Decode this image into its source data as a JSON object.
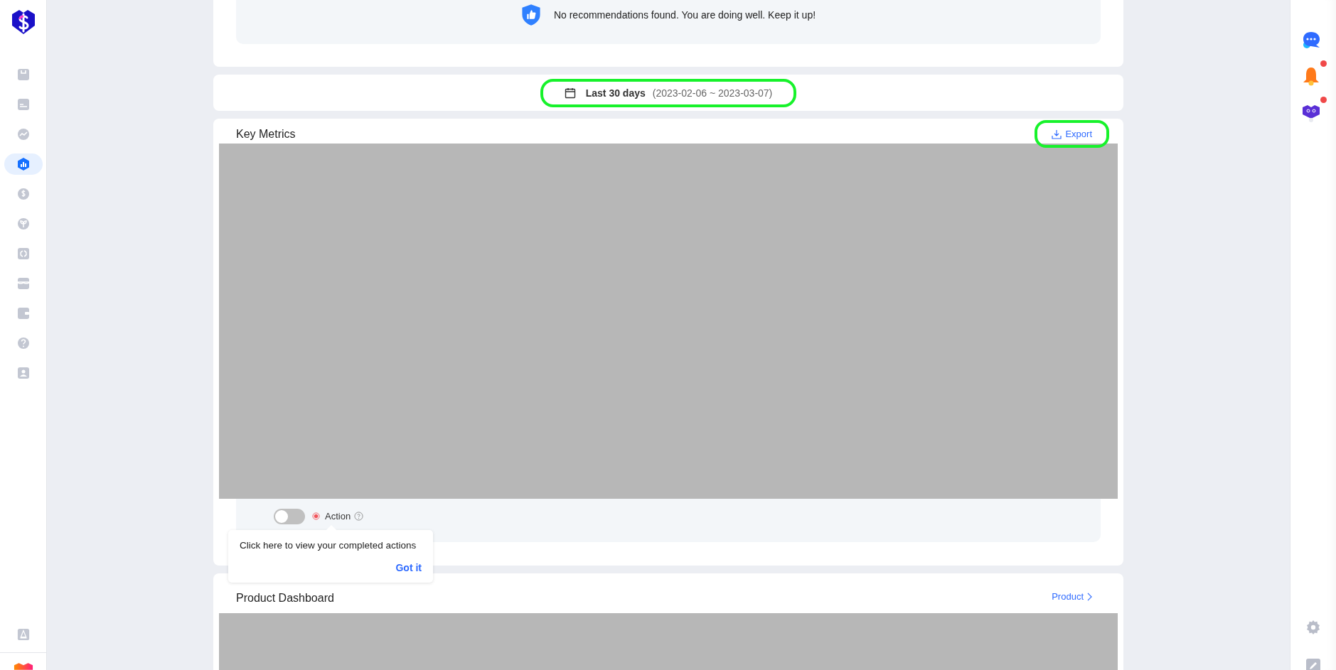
{
  "sidebar": {
    "items": [
      {
        "selected": false
      },
      {
        "selected": false
      },
      {
        "selected": false
      },
      {
        "selected": true
      },
      {
        "selected": false
      },
      {
        "selected": false
      },
      {
        "selected": false
      },
      {
        "selected": false
      },
      {
        "selected": false
      },
      {
        "selected": false
      },
      {
        "selected": false
      }
    ]
  },
  "recommendations": {
    "message": "No recommendations found. You are doing well. Keep it up!"
  },
  "date_range": {
    "label": "Last 30 days",
    "range": "(2023-02-06 ~ 2023-03-07)",
    "highlighted": true
  },
  "key_metrics": {
    "title": "Key Metrics",
    "export": {
      "label": "Export",
      "highlighted": true
    },
    "action_toggle": {
      "on": false,
      "label": "Action"
    }
  },
  "tooltip": {
    "text": "Click here to view your completed actions",
    "button": "Got it"
  },
  "product_dashboard": {
    "title": "Product Dashboard",
    "link": "Product"
  },
  "right_bar": {
    "items": [
      {
        "badge": false
      },
      {
        "badge": true
      },
      {
        "badge": true
      }
    ]
  }
}
